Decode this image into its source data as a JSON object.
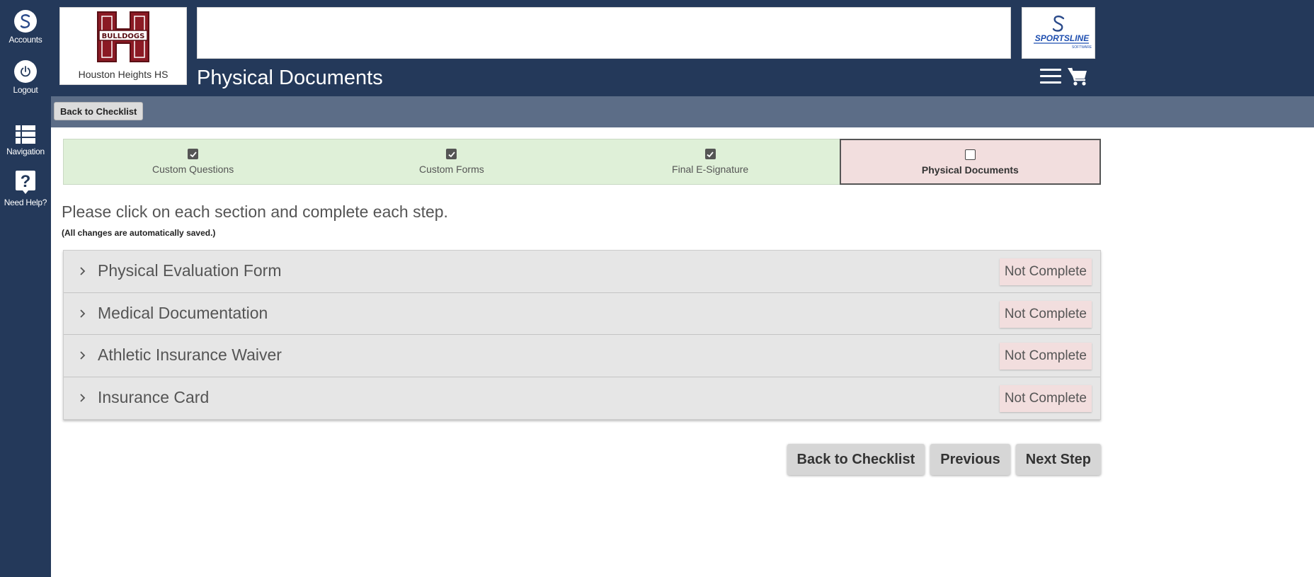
{
  "rail": {
    "accounts_label": "Accounts",
    "logout_label": "Logout",
    "navigation_label": "Navigation",
    "help_label": "Need Help?"
  },
  "header": {
    "school_name": "Houston Heights HS",
    "school_logo_text": "BULLDOGS",
    "page_title": "Physical Documents",
    "brand_name": "SPORTSLINE",
    "brand_sub": "SOFTWARE"
  },
  "subbar": {
    "back_label": "Back to Checklist"
  },
  "steps": [
    {
      "label": "Custom Questions",
      "checked": true
    },
    {
      "label": "Custom Forms",
      "checked": true
    },
    {
      "label": "Final E-Signature",
      "checked": true
    },
    {
      "label": "Physical Documents",
      "checked": false
    }
  ],
  "instruction": "Please click on each section and complete each step.",
  "subnote": "(All changes are automatically saved.)",
  "sections": [
    {
      "title": "Physical Evaluation Form",
      "status": "Not Complete"
    },
    {
      "title": "Medical Documentation",
      "status": "Not Complete"
    },
    {
      "title": "Athletic Insurance Waiver",
      "status": "Not Complete"
    },
    {
      "title": "Insurance Card",
      "status": "Not Complete"
    }
  ],
  "footer": {
    "back_label": "Back to Checklist",
    "previous_label": "Previous",
    "next_label": "Next Step"
  },
  "colors": {
    "navy": "#24395a",
    "subbar": "#5c6d87",
    "step_done": "#dff0d8",
    "step_active": "#f2dede",
    "status_badge": "#f2dede",
    "school_maroon": "#8b1a24"
  }
}
